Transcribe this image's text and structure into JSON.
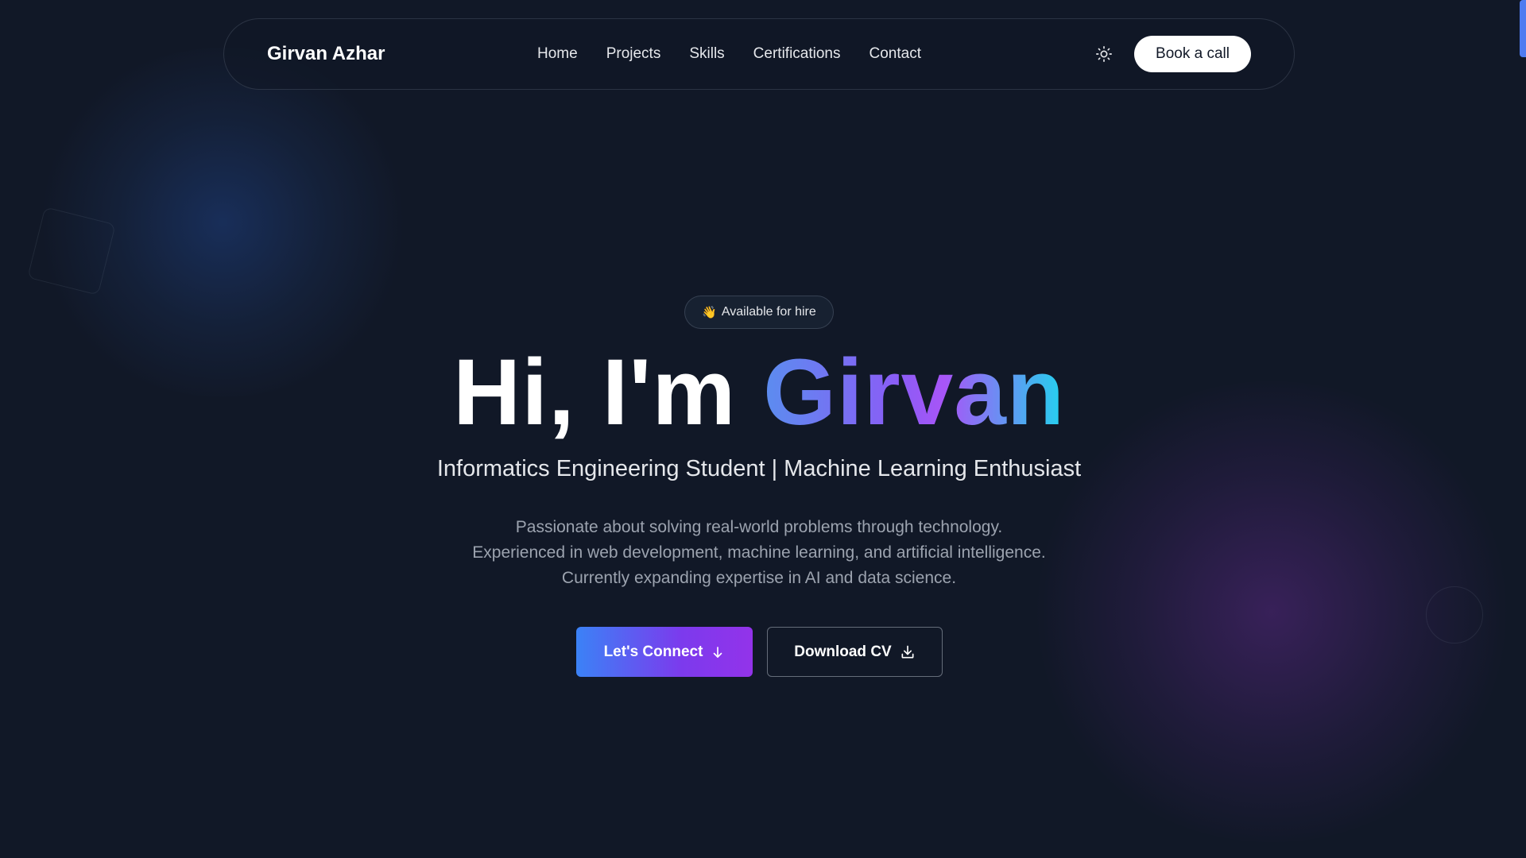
{
  "nav": {
    "brand": "Girvan Azhar",
    "links": [
      "Home",
      "Projects",
      "Skills",
      "Certifications",
      "Contact"
    ],
    "theme_icon": "sun-icon",
    "cta_label": "Book a call"
  },
  "hero": {
    "badge_emoji": "👋",
    "badge_text": "Available for hire",
    "headline_prefix": "Hi, I'm ",
    "headline_name": "Girvan",
    "subtitle": "Informatics Engineering Student | Machine Learning Enthusiast",
    "description": [
      "Passionate about solving real-world problems through technology.",
      "Experienced in web development, machine learning, and artificial intelligence.",
      "Currently expanding expertise in AI and data science."
    ],
    "primary_button": {
      "label": "Let's Connect",
      "icon": "arrow-down-icon"
    },
    "secondary_button": {
      "label": "Download CV",
      "icon": "download-icon"
    }
  },
  "colors": {
    "background": "#111827",
    "accent_blue": "#3b82f6",
    "accent_purple": "#9333ea",
    "accent_cyan": "#22d3ee"
  }
}
